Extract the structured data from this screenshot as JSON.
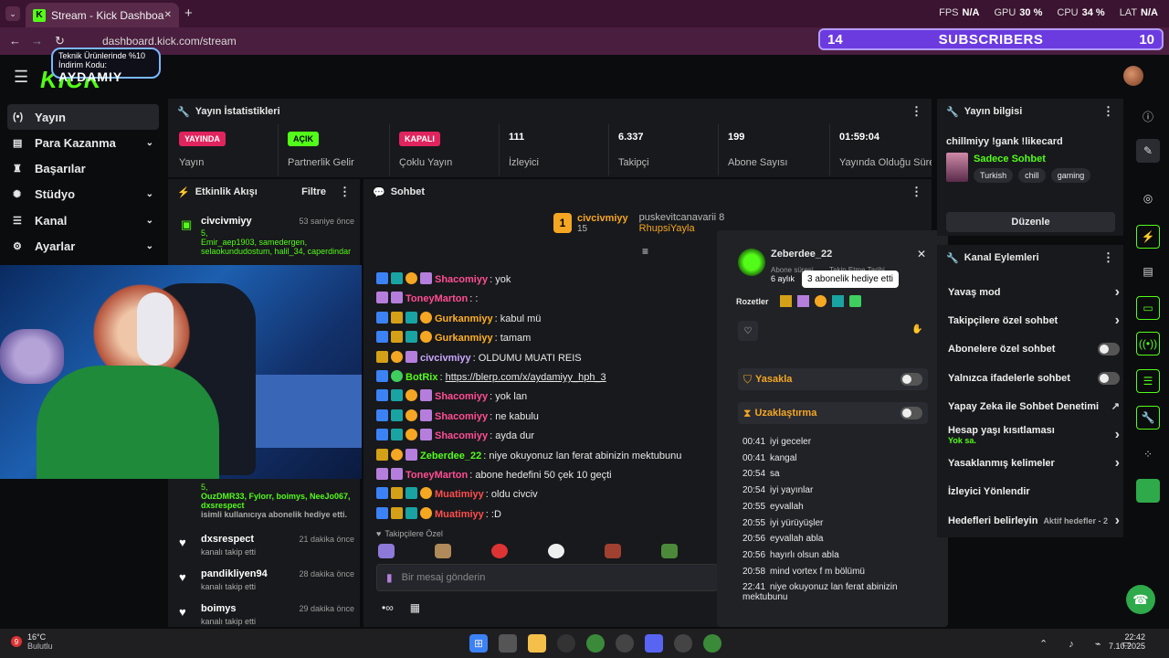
{
  "browser": {
    "tab_title": "Stream - Kick Dashboard",
    "tab_close": "✕",
    "new_tab": "+",
    "url": "dashboard.kick.com/stream",
    "hud": {
      "fps_label": "FPS",
      "fps": "N/A",
      "gpu_label": "GPU",
      "gpu": "30 %",
      "cpu_label": "CPU",
      "cpu": "34 %",
      "lat_label": "LAT",
      "lat": "N/A"
    }
  },
  "overlay": {
    "subs_left": "14",
    "subs_label": "SUBSCRIBERS",
    "subs_right": "10",
    "promo_line": "Teknik Ürünlerinde %10 İndirim Kodu:",
    "promo_code": "AYDAMIY"
  },
  "header": {
    "logo": "KICK"
  },
  "sidebar": {
    "items": [
      {
        "label": "Yayın",
        "icon": "(•)"
      },
      {
        "label": "Para Kazanma",
        "icon": "▤"
      },
      {
        "label": "Başarılar",
        "icon": "♜"
      },
      {
        "label": "Stüdyo",
        "icon": "✺"
      },
      {
        "label": "Kanal",
        "icon": "☰"
      },
      {
        "label": "Ayarlar",
        "icon": "⚙"
      }
    ]
  },
  "stats": {
    "title": "Yayın İstatistikleri",
    "items": [
      {
        "value": "YAYINDA",
        "label": "Yayın"
      },
      {
        "value": "AÇIK",
        "label": "Partnerlik Gelir"
      },
      {
        "value": "KAPALI",
        "label": "Çoklu Yayın"
      },
      {
        "value": "111",
        "label": "İzleyici"
      },
      {
        "value": "6.337",
        "label": "Takipçi"
      },
      {
        "value": "199",
        "label": "Abone Sayısı"
      },
      {
        "value": "01:59:04",
        "label": "Yayında Olduğu Süre"
      }
    ]
  },
  "feed": {
    "title": "Etkinlik Akışı",
    "filter": "Filtre",
    "top": {
      "name": "civcivmiyy",
      "time": "53 saniye önce",
      "count": "5,",
      "names": "Emir_aep1903, samedergen, selaokundudostum, halil_34, caperdindar"
    },
    "mid": {
      "count": "5,",
      "names": "OuzDMR33, Fylorr, boimys, NeeJo067, dxsrespect",
      "text": "isimli kullanıcıya abonelik hediye etti."
    },
    "items": [
      {
        "name": "dxsrespect",
        "time": "21 dakika önce",
        "text": "kanalı takip etti"
      },
      {
        "name": "pandikliyen94",
        "time": "28 dakika önce",
        "text": "kanalı takip etti"
      },
      {
        "name": "boimys",
        "time": "29 dakika önce",
        "text": "kanalı takip etti"
      }
    ]
  },
  "chat": {
    "title": "Sohbet",
    "pinned": {
      "user": "civcivmiyy",
      "count": "15",
      "user2": "puskevitcanavarii",
      "count2": "8",
      "user3": "RhupsiYayla"
    },
    "messages": [
      {
        "user": "Shacomiyy",
        "color": "#ff4d94",
        "text": "yok",
        "badges": [
          "g",
          "t",
          "o",
          "p"
        ]
      },
      {
        "user": "ToneyMarton",
        "color": "#ff4d94",
        "text": ":",
        "badges": [
          "p",
          "p"
        ]
      },
      {
        "user": "Gurkanmiyy",
        "color": "#ffb020",
        "text": "kabul mü",
        "badges": [
          "g",
          "c",
          "t",
          "o"
        ]
      },
      {
        "user": "Gurkanmiyy",
        "color": "#ffb020",
        "text": "tamam",
        "badges": [
          "g",
          "c",
          "t",
          "o"
        ]
      },
      {
        "user": "civcivmiyy",
        "color": "#c9a6ff",
        "text": "OLDUMU MUATI REIS",
        "badges": [
          "c",
          "o",
          "p"
        ]
      },
      {
        "user": "BotRix",
        "color": "#53fc18",
        "text": "https://blerp.com/x/aydamiyy_hph_3",
        "badges": [
          "g",
          "v"
        ]
      },
      {
        "user": "Shacomiyy",
        "color": "#ff4d94",
        "text": "yok lan",
        "badges": [
          "g",
          "t",
          "o",
          "p"
        ]
      },
      {
        "user": "Shacomiyy",
        "color": "#ff4d94",
        "text": "ne kabulu",
        "badges": [
          "g",
          "t",
          "o",
          "p"
        ]
      },
      {
        "user": "Shacomiyy",
        "color": "#ff4d94",
        "text": "ayda dur",
        "badges": [
          "g",
          "t",
          "o",
          "p"
        ]
      },
      {
        "user": "Zeberdee_22",
        "color": "#53fc18",
        "text": "niye okuyonuz lan ferat abinizin mektubunu",
        "badges": [
          "c",
          "o",
          "p"
        ]
      },
      {
        "user": "ToneyMarton",
        "color": "#ff4d94",
        "text": "abone hedefini 50 çek 10 geçti",
        "badges": [
          "p",
          "p"
        ]
      },
      {
        "user": "Muatimiyy",
        "color": "#ff4d4d",
        "text": "oldu civciv",
        "badges": [
          "g",
          "c",
          "t",
          "o"
        ]
      },
      {
        "user": "Muatimiyy",
        "color": "#ff4d4d",
        "text": ":D",
        "badges": [
          "g",
          "c",
          "t",
          "o"
        ]
      }
    ],
    "followers_only": "Takipçilere Özel",
    "input_placeholder": "Bir mesaj gönderin"
  },
  "card": {
    "username": "Zeberdee_22",
    "sub_label": "Abone süresi",
    "sub_value": "6 aylık",
    "follow_label": "Takip Etme Tarihi",
    "tooltip": "3 abonelik hediye etti",
    "badges_label": "Rozetler",
    "ban_label": "Yasakla",
    "timeout_label": "Uzaklaştırma",
    "history": [
      {
        "time": "00:41",
        "text": "iyi geceler"
      },
      {
        "time": "00:41",
        "text": "kangal"
      },
      {
        "time": "20:54",
        "text": "sa"
      },
      {
        "time": "20:54",
        "text": "iyi yayınlar"
      },
      {
        "time": "20:55",
        "text": "eyvallah"
      },
      {
        "time": "20:55",
        "text": "iyi yürüyüşler"
      },
      {
        "time": "20:56",
        "text": "eyvallah abla"
      },
      {
        "time": "20:56",
        "text": "hayırlı olsun abla"
      },
      {
        "time": "20:58",
        "text": "mind vortex f m bölümü"
      },
      {
        "time": "22:41",
        "text": "niye okuyonuz lan ferat abinizin mektubunu"
      }
    ]
  },
  "info": {
    "title": "Yayın bilgisi",
    "stream_title": "chillmiyy !gank !likecard",
    "category": "Sadece Sohbet",
    "tags": [
      "Turkish",
      "chill",
      "gaming"
    ],
    "edit": "Düzenle"
  },
  "actions": {
    "title": "Kanal Eylemleri",
    "items": [
      {
        "label": "Yavaş mod",
        "type": "chev"
      },
      {
        "label": "Takipçilere özel sohbet",
        "type": "chev"
      },
      {
        "label": "Abonelere özel sohbet",
        "type": "toggle"
      },
      {
        "label": "Yalnızca ifadelerle sohbet",
        "type": "toggle"
      },
      {
        "label": "Yapay Zeka ile Sohbet Denetimi",
        "type": "ext"
      },
      {
        "label": "Hesap yaşı kısıtlaması",
        "type": "chev",
        "sub": "Yok sa."
      },
      {
        "label": "Yasaklanmış kelimeler",
        "type": "chev"
      },
      {
        "label": "İzleyici Yönlendir",
        "type": "none"
      },
      {
        "label": "Hedefleri belirleyin",
        "type": "chev",
        "sub2": "Aktif hedefler - 2"
      }
    ]
  },
  "taskbar": {
    "temp": "16°C",
    "weather": "Bulutlu",
    "time": "22:42",
    "date": "7.10.2025",
    "badge": "9"
  },
  "colors": {
    "accent": "#53fc18",
    "live": "#e0245e",
    "panel": "#18191c"
  }
}
